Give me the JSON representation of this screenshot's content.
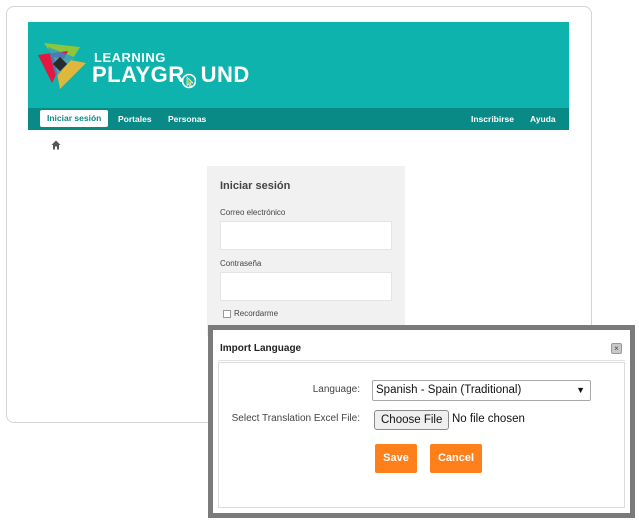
{
  "site": {
    "logo_line1": "LEARNING",
    "logo_line2": "PLAYGR OUND",
    "brand_color": "#0fb3ae",
    "nav_color": "#0a8a86"
  },
  "nav": {
    "left": [
      "Iniciar sesión",
      "Portales",
      "Personas"
    ],
    "right": [
      "Inscribirse",
      "Ayuda"
    ]
  },
  "login": {
    "title": "Iniciar sesión",
    "email_label": "Correo electrónico",
    "password_label": "Contraseña",
    "remember_label": "Recordarme"
  },
  "dialog": {
    "title": "Import Language",
    "language_label": "Language:",
    "language_value": "Spanish - Spain (Traditional)",
    "file_label": "Select Translation Excel File:",
    "file_button": "Choose File",
    "file_status": "No file chosen",
    "save_label": "Save",
    "cancel_label": "Cancel",
    "close_glyph": "×",
    "accent_color": "#ff7f1a"
  }
}
